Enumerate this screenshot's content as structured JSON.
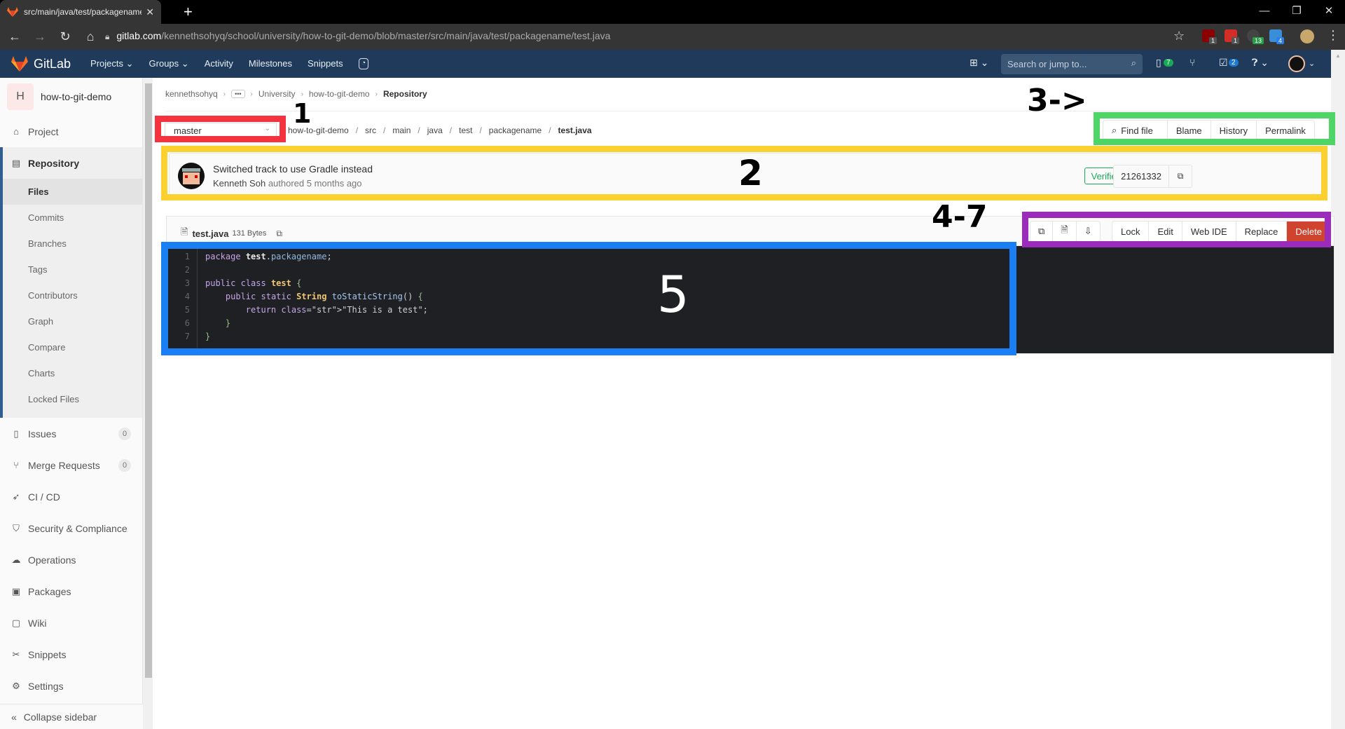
{
  "browser": {
    "tab_title": "src/main/java/test/packagename",
    "url_host": "gitlab.com",
    "url_path": "/kennethsohyq/school/university/how-to-git-demo/blob/master/src/main/java/test/packagename/test.java",
    "extensions": [
      {
        "name": "ublock-origin",
        "badge": "1",
        "color": "#8b0000",
        "badge_color": "#555555"
      },
      {
        "name": "lastpass",
        "badge": "1",
        "color": "#d32d27",
        "badge_color": "#555555"
      },
      {
        "name": "extension-3",
        "badge": "13",
        "color": "#444444",
        "badge_color": "#2a9d4b"
      },
      {
        "name": "extension-4",
        "badge": "4",
        "color": "#3a8ed8",
        "badge_color": "#2b7de9"
      }
    ]
  },
  "header": {
    "brand": "GitLab",
    "nav": [
      "Projects",
      "Groups",
      "Activity",
      "Milestones",
      "Snippets"
    ],
    "search_placeholder": "Search or jump to...",
    "issues_count": "7",
    "todos_count": "2"
  },
  "sidebar": {
    "project_initial": "H",
    "project_name": "how-to-git-demo",
    "items": [
      {
        "label": "Project",
        "icon": "home-icon"
      },
      {
        "label": "Repository",
        "icon": "document-icon"
      },
      {
        "label": "Issues",
        "icon": "issues-icon",
        "count": "0"
      },
      {
        "label": "Merge Requests",
        "icon": "merge-request-icon",
        "count": "0"
      },
      {
        "label": "CI / CD",
        "icon": "rocket-icon"
      },
      {
        "label": "Security & Compliance",
        "icon": "shield-icon"
      },
      {
        "label": "Operations",
        "icon": "cloud-gear-icon"
      },
      {
        "label": "Packages",
        "icon": "package-icon"
      },
      {
        "label": "Wiki",
        "icon": "book-icon"
      },
      {
        "label": "Snippets",
        "icon": "scissors-icon"
      },
      {
        "label": "Settings",
        "icon": "gear-icon"
      }
    ],
    "repository_sub": [
      "Files",
      "Commits",
      "Branches",
      "Tags",
      "Contributors",
      "Graph",
      "Compare",
      "Charts",
      "Locked Files"
    ],
    "collapse_label": "Collapse sidebar"
  },
  "breadcrumbs": [
    "kennethsohyq",
    "University",
    "how-to-git-demo",
    "Repository"
  ],
  "branch": "master",
  "path": [
    "how-to-git-demo",
    "src",
    "main",
    "java",
    "test",
    "packagename",
    "test.java"
  ],
  "tree_actions": {
    "find_file": "Find file",
    "blame": "Blame",
    "history": "History",
    "permalink": "Permalink"
  },
  "commit": {
    "message": "Switched track to use Gradle instead",
    "author": "Kenneth Soh",
    "authored_text": "authored 5 months ago",
    "verified": "Verified",
    "sha": "21261332"
  },
  "file": {
    "name": "test.java",
    "size": "131 Bytes",
    "actions": {
      "lock": "Lock",
      "edit": "Edit",
      "web_ide": "Web IDE",
      "replace": "Replace",
      "delete": "Delete"
    },
    "lines": [
      "package test.packagename;",
      "",
      "public class test {",
      "    public static String toStaticString() {",
      "        return \"This is a test\";",
      "    }",
      "}"
    ]
  },
  "annotations": [
    {
      "label": "1",
      "color": "#f5333f",
      "target": "branch-selector"
    },
    {
      "label": "2",
      "color": "#fcd02f",
      "target": "commit-info"
    },
    {
      "label": "3->",
      "color": "#4fd466",
      "target": "tree-action-buttons"
    },
    {
      "label": "4-7",
      "color": "#9b2cbb",
      "target": "file-action-buttons"
    },
    {
      "label": "5",
      "color": "#1a7ff5",
      "target": "code-view"
    }
  ]
}
